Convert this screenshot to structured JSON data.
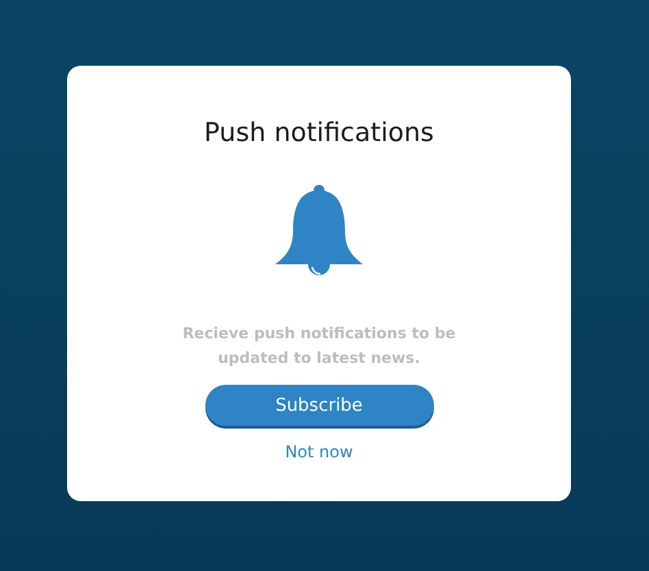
{
  "card": {
    "title": "Push notifications",
    "message": "Recieve push notifications to be updated to latest news.",
    "buttons": [
      {
        "kind": "primary",
        "label": "Subscribe"
      },
      {
        "kind": "link",
        "label": "Not now"
      }
    ]
  }
}
